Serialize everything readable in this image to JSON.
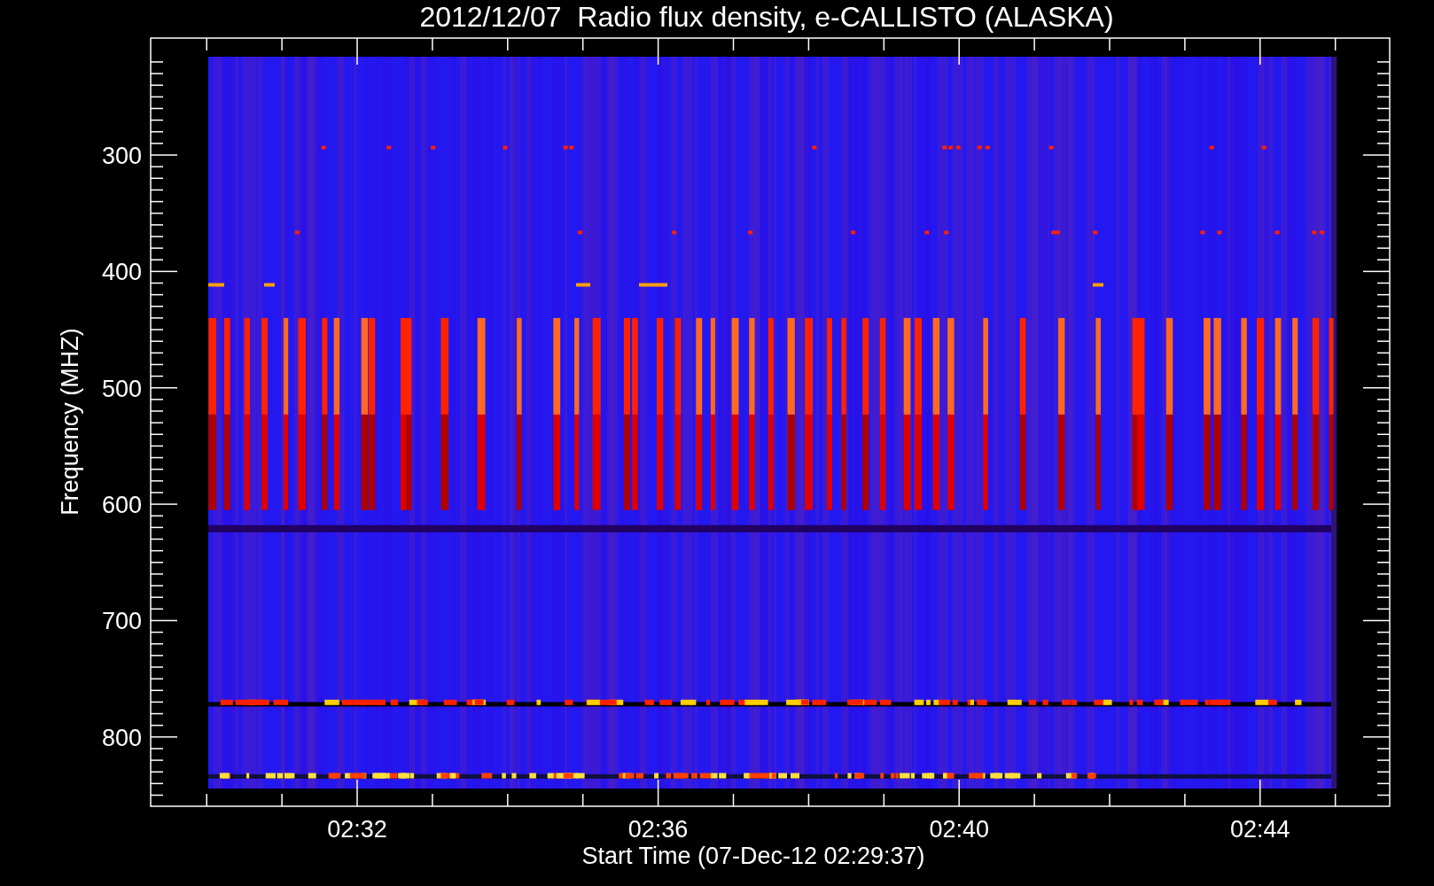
{
  "title": "2012/12/07  Radio flux density, e-CALLISTO (ALASKA)",
  "plot": {
    "y_axis": {
      "label": "Frequency (MHZ)",
      "tick_labels": [
        "300",
        "400",
        "500",
        "600",
        "700",
        "800"
      ]
    },
    "x_axis": {
      "label": "Start Time (07-Dec-12 02:29:37)",
      "tick_labels": [
        "02:32",
        "02:36",
        "02:40",
        "02:44"
      ]
    }
  }
}
